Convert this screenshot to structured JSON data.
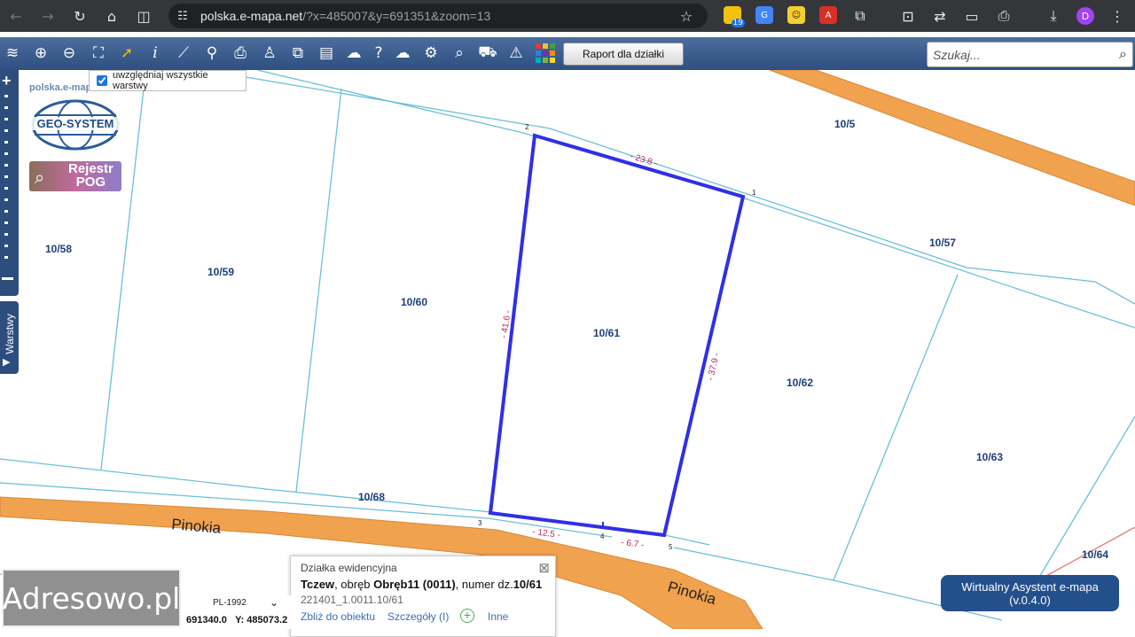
{
  "browser": {
    "url_host": "polska.e-mapa.net",
    "url_path": "/?x=485007&y=691351&zoom=13",
    "profile_initial": "D",
    "extension_badge": "19"
  },
  "toolbar": {
    "report_button": "Raport dla działki",
    "search_placeholder": "Szukaj..."
  },
  "overlay": {
    "all_layers_label": "uwzględniaj wszystkie warstwy",
    "all_layers_checked": true,
    "logo_site": "polska.e-mapa.net",
    "logo_geosystem": "GEO-SYSTEM",
    "logo_rejestr_line1": "Rejestr",
    "logo_rejestr_line2": "POG",
    "layers_tab": "Warstwy"
  },
  "map": {
    "parcels": [
      "10/5",
      "10/57",
      "10/58",
      "10/59",
      "10/60",
      "10/61",
      "10/62",
      "10/63",
      "10/64",
      "10/68"
    ],
    "street_name": "Pinokia",
    "vertices": [
      "1",
      "2",
      "3",
      "4",
      "5"
    ],
    "dimensions": [
      "- 23.8 -",
      "- 41.6 -",
      "- 37.9 -",
      "- 12.5 -",
      "- 6.7 -"
    ],
    "colors": {
      "selected_parcel": "#2f2fe8",
      "parcel_lines": "#6cc0d8",
      "road": "#f0a24e"
    }
  },
  "popup": {
    "title": "Działka ewidencyjna",
    "city": "Tczew",
    "sep1": ", obręb ",
    "obreb": "Obręb11 (0011)",
    "sep2": ", numer dz.",
    "number": "10/61",
    "teryt_id": "221401_1.0011.10/61",
    "zoom_link": "Zbliż do obiektu",
    "details_link": "Szczegóły (I)",
    "other_link": "Inne"
  },
  "coords": {
    "crs": "PL-1992",
    "x": "691340.0",
    "y": "Y: 485073.2"
  },
  "watermark": "Adresowo.pl",
  "assistant": {
    "line1": "Wirtualny Asystent e-mapa",
    "line2": "(v.0.4.0)"
  }
}
